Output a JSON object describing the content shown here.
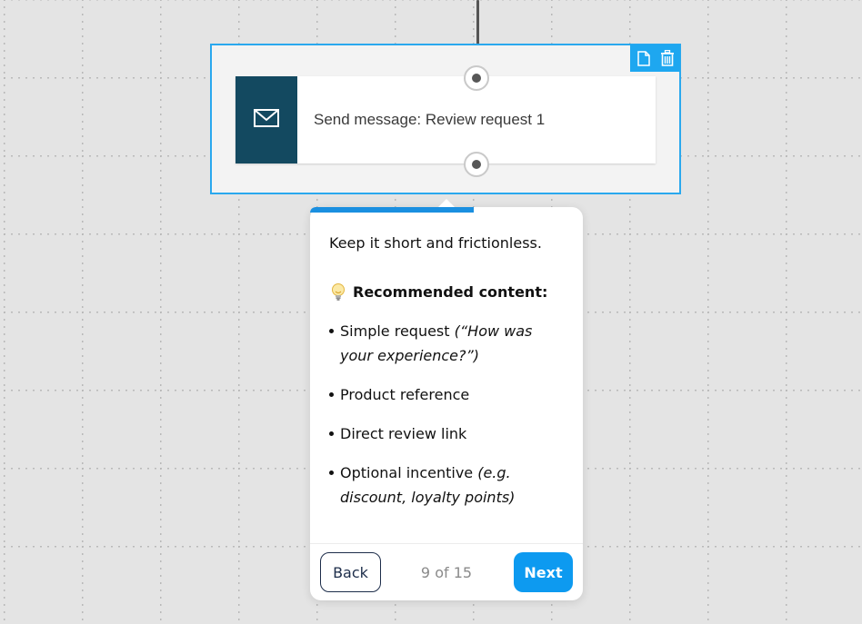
{
  "node": {
    "label": "Send message: Review request 1",
    "icon": "envelope-icon",
    "accent_color": "#134960",
    "selection_color": "#2aa8ee"
  },
  "toolbar": {
    "icons": [
      "document-icon",
      "trash-icon"
    ]
  },
  "tour": {
    "progress": 0.6,
    "intro": "Keep it short and frictionless.",
    "heading_emoji": "💡",
    "heading": "Recommended content:",
    "items": [
      {
        "text": "Simple request ",
        "italic": "(“How was your experience?”)"
      },
      {
        "text": "Product reference",
        "italic": ""
      },
      {
        "text": "Direct review link",
        "italic": ""
      },
      {
        "text": "Optional incentive ",
        "italic": "(e.g. discount, loyalty points)"
      }
    ],
    "back_label": "Back",
    "step_label": "9 of 15",
    "next_label": "Next",
    "next_color": "#0d9af0"
  }
}
